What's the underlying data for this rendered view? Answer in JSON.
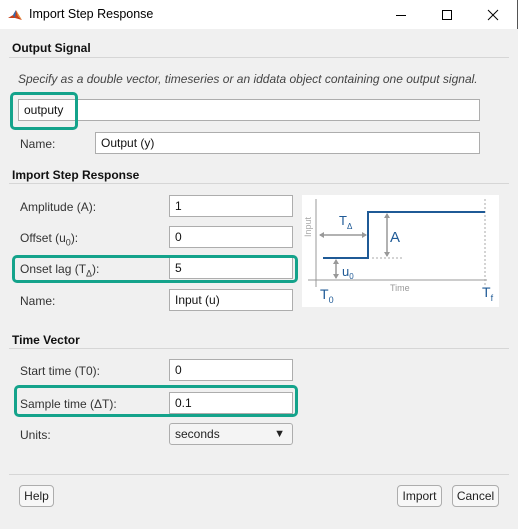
{
  "window": {
    "title": "Import Step Response",
    "app_icon": "matlab-icon",
    "controls": {
      "minimize": "minimize-icon",
      "maximize": "maximize-icon",
      "close": "close-icon"
    }
  },
  "output_signal": {
    "heading": "Output Signal",
    "hint": "Specify as a double vector, timeseries or an iddata object containing one output signal.",
    "signal_value": "outputy",
    "name_label": "Name:",
    "name_value": "Output (y)"
  },
  "step_response": {
    "heading": "Import Step Response",
    "amplitude_label": "Amplitude (A):",
    "amplitude_value": "1",
    "offset_label_main": "Offset (u",
    "offset_label_sub": "0",
    "offset_label_tail": "):",
    "offset_value": "0",
    "onset_label_main": "Onset lag (T",
    "onset_label_sub": "Δ",
    "onset_label_tail": "):",
    "onset_value": "5",
    "name_label": "Name:",
    "name_value": "Input (u)",
    "diagram": {
      "y_axis_label": "Input",
      "x_axis_label": "Time",
      "t_delta": "T",
      "t_delta_sub": "Δ",
      "amplitude": "A",
      "u0": "u",
      "u0_sub": "0",
      "t0": "T",
      "t0_sub": "0",
      "tf": "T",
      "tf_sub": "f",
      "line_color": "#1f5a96"
    }
  },
  "time_vector": {
    "heading": "Time Vector",
    "start_label": "Start time (T0):",
    "start_value": "0",
    "sample_label": "Sample time (ΔT):",
    "sample_value": "0.1",
    "units_label": "Units:",
    "units_value": "seconds",
    "units_arrow": "▼"
  },
  "footer": {
    "help": "Help",
    "import": "Import",
    "cancel": "Cancel"
  },
  "highlight_color": "#14a38b"
}
